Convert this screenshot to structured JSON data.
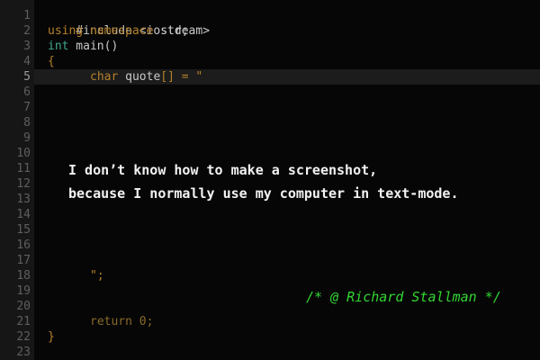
{
  "editor": {
    "line_numbers": [
      "1",
      "2",
      "3",
      "4",
      "5",
      "6",
      "7",
      "8",
      "9",
      "10",
      "11",
      "12",
      "13",
      "14",
      "15",
      "16",
      "17",
      "18",
      "19",
      "20",
      "21",
      "22",
      "23"
    ],
    "current_line": "5",
    "code": {
      "line1": "#include <iostream>",
      "line2_kw": "using namespace",
      "line2_rest": " std;",
      "line3_type": "int",
      "line3_rest": " main()",
      "line4": "{",
      "line5_kw": "char",
      "line5_ident": " quote",
      "line5_rest": "[] = \"",
      "line18": "\";",
      "line21_kw": "return",
      "line21_rest": " 0;",
      "line22": "}"
    },
    "quote_text": {
      "line1": "I don’t know how to make a screenshot,",
      "line2": "because I normally use my computer in text-mode."
    },
    "credit": "/* @ Richard Stallman */"
  },
  "colors": {
    "background": "#060606",
    "gutter": "#161616",
    "keyword": "#b5802a",
    "type": "#3fa88c",
    "comment": "#33d633",
    "text": "#f2f2f2"
  }
}
